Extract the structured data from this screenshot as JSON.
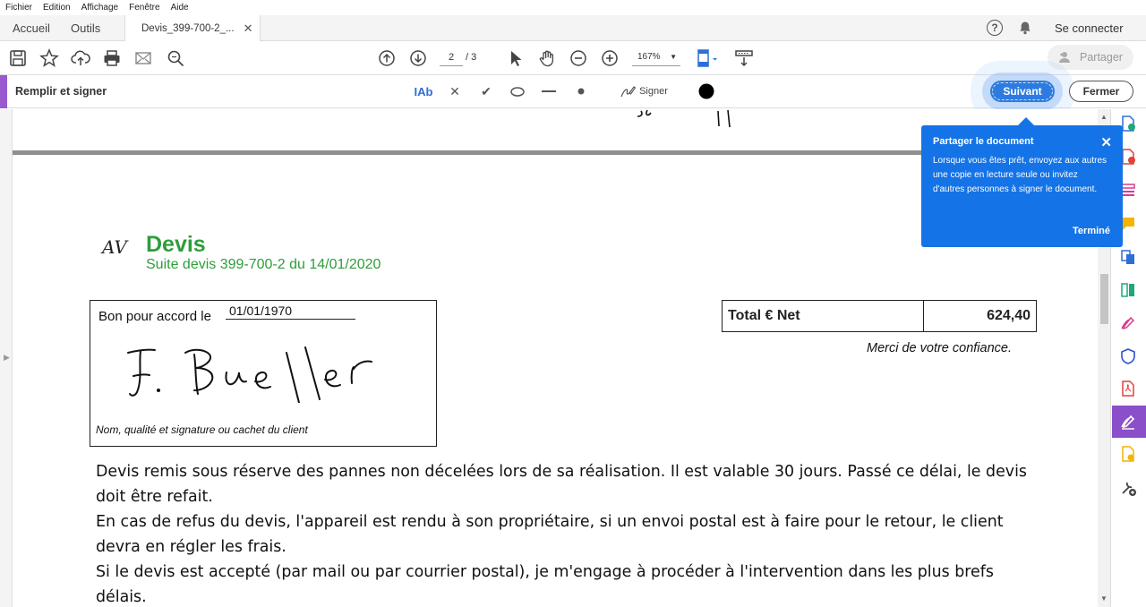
{
  "menu": [
    "Fichier",
    "Edition",
    "Affichage",
    "Fenêtre",
    "Aide"
  ],
  "tabs": {
    "home": "Accueil",
    "tools": "Outils",
    "document": "Devis_399-700-2_..."
  },
  "header": {
    "connect": "Se connecter"
  },
  "toolbar": {
    "current_page": "2",
    "total_pages": "/  3",
    "zoom": "167%",
    "share_label": "Partager"
  },
  "fill_sign": {
    "title": "Remplir et signer",
    "text_tool": "IAb",
    "sign_label": "Signer",
    "next_label": "Suivant",
    "close_label": "Fermer"
  },
  "popover": {
    "title": "Partager le document",
    "body": "Lorsque vous êtes prêt, envoyez aux autres une copie en lecture seule ou invitez d'autres personnes à signer le document.",
    "done": "Terminé"
  },
  "document": {
    "logo_text": "AV",
    "title": "Devis",
    "subtitle": "Suite devis 399-700-2 du 14/01/2020",
    "approval_label": "Bon pour accord le",
    "approval_date": "01/01/1970",
    "signature_caption": "Nom, qualité et signature ou cachet du client",
    "signature_text": "F. Bueller",
    "total_label": "Total € Net",
    "total_value": "624,40",
    "thanks": "Merci de votre confiance.",
    "paragraph_1": "Devis remis sous réserve des pannes non décelées lors de sa réalisation. Il est valable 30 jours. Passé ce délai, le devis doit être refait.",
    "paragraph_2": "En cas de refus du devis, l'appareil est rendu à son propriétaire, si un envoi postal est à faire pour le retour, le client devra en régler les frais.",
    "paragraph_3": "Si le devis est  accepté (par mail ou par courrier postal), je m'engage à procéder à l'intervention dans les plus brefs délais."
  },
  "colors": {
    "accent_purple": "#9b59d0",
    "primary_blue": "#1473e6",
    "devis_green": "#2e9e3a"
  }
}
